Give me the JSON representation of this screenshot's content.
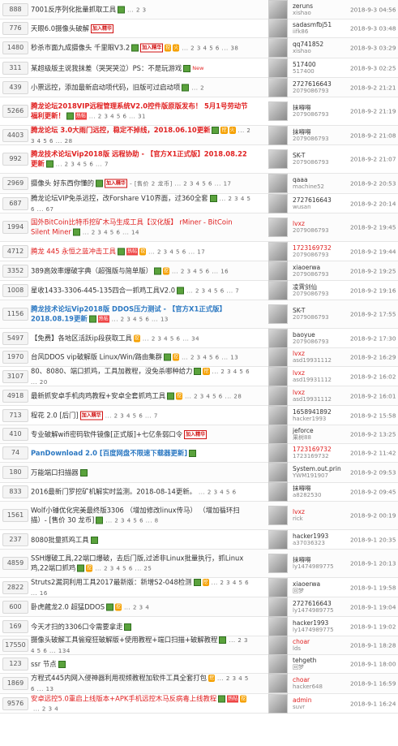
{
  "rows": [
    {
      "count": "888",
      "title": "7001反序列化批量抓取工具",
      "style": "normal",
      "badges": [
        "img"
      ],
      "pages": "... 2 3",
      "author": "zeruns",
      "sub": "xishao",
      "date": "2018-9-3 04:56"
    },
    {
      "count": "776",
      "title": "天眼6.0摄像头破解",
      "style": "normal",
      "badges": [
        "label:加入精华"
      ],
      "pages": "",
      "author": "sadasmfbj51",
      "sub": "iifk86",
      "date": "2018-9-3 03:48"
    },
    {
      "count": "1480",
      "title": "秒杀市面九成摄像头 千里眼V3.2",
      "style": "normal",
      "badges": [
        "img",
        "label:加入精华",
        "dig:挖",
        "dig:火"
      ],
      "pages": "... 2 3 4 5 6 ... 38",
      "author": "qq741852",
      "sub": "xishao",
      "date": "2018-9-3 03:29"
    },
    {
      "count": "311",
      "title": "某超级版主说我抹差（哭哭哭泣）PS：不是玩游戏",
      "style": "normal",
      "badges": [
        "img",
        "new:New"
      ],
      "pages": "",
      "author": "517400",
      "sub": "517400",
      "date": "2018-9-3 02:25"
    },
    {
      "count": "439",
      "title": "小票远控，添加最新启动项代码，旧版可过启动项",
      "style": "normal",
      "badges": [
        "img"
      ],
      "pages": "... 2",
      "author": "2727616643",
      "sub": "2079086793",
      "date": "2018-9-2 21:21"
    },
    {
      "count": "5266",
      "title": "腾龙论坛2018VIP远程管理系统V2.0控件版原版发布！ 5月1号劳动节福利更新！",
      "style": "red",
      "badges": [
        "img",
        "hot:热帖"
      ],
      "pages": "... 2 3 4 5 6 ... 31",
      "author": "抹嘚嘚",
      "sub": "2079086793",
      "date": "2018-9-2 21:19"
    },
    {
      "count": "4403",
      "title": "腾龙论坛 3.0大雨门远控，稳定不掉线，2018.06.10更新",
      "style": "red",
      "badges": [
        "img",
        "dig:挖",
        "dig:火"
      ],
      "pages": "... 2 3 4 5 6 ... 28",
      "author": "抹嘚嘚",
      "sub": "2079086793",
      "date": "2018-9-2 21:08"
    },
    {
      "count": "992",
      "title": "腾龙技术论坛Vip2018版 远程协助 - 【官方X1正式版】2018.08.22更新",
      "style": "red",
      "badges": [
        "img"
      ],
      "pages": "... 2 3 4 5 6 ... 7",
      "author": "SK-T",
      "sub": "2079086793",
      "date": "2018-9-2 21:07"
    },
    {
      "count": "2969",
      "title": "摄像头 好东西你懂的",
      "style": "normal",
      "badges": [
        "img",
        "label:加入精华"
      ],
      "pages": "- [售价 2 龙币] ... 2 3 4 5 6 ... 17",
      "author": "qaaa",
      "sub": "machine52",
      "date": "2018-9-2 20:53"
    },
    {
      "count": "687",
      "title": "腾龙论坛VIP免杀远控，改Forshare V10界面，过360全套",
      "style": "normal",
      "badges": [
        "img"
      ],
      "pages": "... 2 3 4 5 6 ... 67",
      "author": "2727616643",
      "sub": "wusan",
      "date": "2018-9-2 20:14"
    },
    {
      "count": "1994",
      "title": "国外BitCoin比特币挖矿木马生成工具【汉化版】 rMiner - BitCoin Silent Miner",
      "style": "redthin",
      "badges": [
        "img"
      ],
      "pages": "... 2 3 4 5 6 ... 14",
      "author": "lvxz",
      "sub": "2079086793",
      "date": "2018-9-2 19:45"
    },
    {
      "count": "4712",
      "title": "腾龙 445 永恒之蓝冲击工具",
      "style": "redthin",
      "badges": [
        "img",
        "hot:热帖",
        "dig:挖"
      ],
      "pages": "... 2 3 4 5 6 ... 17",
      "author": "1723169732",
      "sub": "2079086793",
      "date": "2018-9-2 19:44"
    },
    {
      "count": "3352",
      "title": "389高效率爆破字典（超强版与简单版）",
      "style": "normal",
      "badges": [
        "img",
        "dig:挖"
      ],
      "pages": "... 2 3 4 5 6 ... 16",
      "author": "xiaoerwa",
      "sub": "2079086793",
      "date": "2018-9-2 19:25"
    },
    {
      "count": "1008",
      "title": "星收1433-3306-445-135四合一抓鸡工具V2.0",
      "style": "normal",
      "badges": [
        "img"
      ],
      "pages": "... 2 3 4 5 6 ... 7",
      "author": "凌霄剑仙",
      "sub": "2079086793",
      "date": "2018-9-2 19:16"
    },
    {
      "count": "1156",
      "title": "腾龙技术论坛Vip2018版 DDOS压力测试 - 【官方X1正式版】2018.08.19更新",
      "style": "blue",
      "badges": [
        "img",
        "hot:热帖"
      ],
      "pages": "... 2 3 4 5 6 ... 13",
      "author": "SK-T",
      "sub": "2079086793",
      "date": "2018-9-2 17:55"
    },
    {
      "count": "5497",
      "title": "【免费】各地区活跃ip段获取工具",
      "style": "normal",
      "badges": [
        "dig:挖"
      ],
      "pages": "... 2 3 4 5 6 ... 34",
      "author": "baoyue",
      "sub": "2079086793",
      "date": "2018-9-2 17:30"
    },
    {
      "count": "1970",
      "title": "台风DDOS vip破解版 Linux/Win/路由集群",
      "style": "normal",
      "badges": [
        "img",
        "dig:挖"
      ],
      "pages": "... 2 3 4 5 6 ... 13",
      "author": "lvxz",
      "sub": "asd19931112",
      "date": "2018-9-2 16:29"
    },
    {
      "count": "3107",
      "title": "80、8080、端口抓鸡，工具加教程，没免杀哪种给力",
      "style": "normal",
      "badges": [
        "img",
        "dig:挖"
      ],
      "pages": "... 2 3 4 5 6 ... 20",
      "author": "lvxz",
      "sub": "asd19931112",
      "date": "2018-9-2 16:02"
    },
    {
      "count": "4918",
      "title": "最新抓安卓手机肉鸡教程+安卓全套抓鸡工具",
      "style": "normal",
      "badges": [
        "img",
        "dig:挖"
      ],
      "pages": "... 2 3 4 5 6 ... 28",
      "author": "lvxz",
      "sub": "asd19931112",
      "date": "2018-9-2 16:01"
    },
    {
      "count": "713",
      "title": "程花 2.0 [后门]",
      "style": "normal",
      "badges": [
        "label:加入精华"
      ],
      "pages": "... 2 3 4 5 6 ... 7",
      "author": "1658941892",
      "sub": "hacker1993",
      "date": "2018-9-2 15:58"
    },
    {
      "count": "410",
      "title": "专业破解wifi密码软件镜像[正式版]+七亿条弱口令",
      "style": "normal",
      "badges": [
        "label:加入精华"
      ],
      "pages": "",
      "author": "jeforce",
      "sub": "果树88",
      "date": "2018-9-2 13:25"
    },
    {
      "count": "74",
      "title": "PanDownload 2.0 [百度网盘不限速下载器更新]",
      "style": "blue",
      "badges": [
        "img"
      ],
      "pages": "",
      "author": "1723169732",
      "sub": "1723169732",
      "date": "2018-9-2 11:42"
    },
    {
      "count": "180",
      "title": "万能端口扫描器",
      "style": "normal",
      "badges": [
        "img"
      ],
      "pages": "",
      "author": "System.out.prin",
      "sub": "YWM191907",
      "date": "2018-9-2 09:53"
    },
    {
      "count": "833",
      "title": "2016最新门罗挖矿机解实时监测。2018-08-14更新。",
      "style": "normal",
      "badges": [],
      "pages": "... 2 3 4 5 6",
      "author": "抹嘚嘚",
      "sub": "a8282530",
      "date": "2018-9-2 09:45"
    },
    {
      "count": "1561",
      "title": "Wolf小锤优化完美最终版3306 （增加修改linux传马） （增加循环扫描）- [售价 30 龙币]",
      "style": "normal",
      "badges": [
        "img"
      ],
      "pages": "... 2 3 4 5 6 ... 8",
      "author": "lvxz",
      "sub": "rick",
      "date": "2018-9-2 00:19"
    },
    {
      "count": "237",
      "title": "8080批量抓鸡工具",
      "style": "normal",
      "badges": [
        "img"
      ],
      "pages": "",
      "author": "hacker1993",
      "sub": "a37036323",
      "date": "2018-9-1 20:35"
    },
    {
      "count": "4859",
      "title": "SSH爆破工具,22端口爆破，去后门版,过滤非Linux批量执行，抓Linux鸡,22端口抓鸡",
      "style": "normal",
      "badges": [
        "img",
        "dig:挖"
      ],
      "pages": "... 2 3 4 5 6 ... 25",
      "author": "抹嘚嘚",
      "sub": "ly1474989775",
      "date": "2018-9-1 20:13"
    },
    {
      "count": "2822",
      "title": "Struts2漏洞利用工具2017最新版：新增S2-048检测",
      "style": "normal",
      "badges": [
        "img",
        "dig:挖"
      ],
      "pages": "... 2 3 4 5 6 ... 16",
      "author": "xiaoerwa",
      "sub": "回梦",
      "date": "2018-9-1 19:58"
    },
    {
      "count": "600",
      "title": "卧虎藏龙2.0 超猛DDOS",
      "style": "normal",
      "badges": [
        "img",
        "dig:挖"
      ],
      "pages": "... 2 3 4",
      "author": "2727616643",
      "sub": "ly1474989775",
      "date": "2018-9-1 19:04"
    },
    {
      "count": "169",
      "title": "今天才扫的3306口令需要拿走",
      "style": "normal",
      "badges": [
        "img"
      ],
      "pages": "",
      "author": "hacker1993",
      "sub": "ly1474989775",
      "date": "2018-9-1 19:02"
    },
    {
      "count": "17550",
      "title": "摄像头破解工具偷窥狂破解版+使用教程+端口扫描+破解教程",
      "style": "normal",
      "badges": [
        "img"
      ],
      "pages": "... 2 3 4 5 6 ... 134",
      "author": "choar",
      "sub": "lds",
      "date": "2018-9-1 18:28"
    },
    {
      "count": "123",
      "title": "ssr 节点",
      "style": "normal",
      "badges": [
        "img"
      ],
      "pages": "",
      "author": "tehgeth",
      "sub": "回梦",
      "date": "2018-9-1 18:00"
    },
    {
      "count": "1869",
      "title": "方程式445内网入侵神器利用视频教程加软件工具全套打包",
      "style": "normal",
      "badges": [
        "dig:挖"
      ],
      "pages": "... 2 3 4 5 6 ... 13",
      "author": "choar",
      "sub": "hacker648",
      "date": "2018-9-1 16:59"
    },
    {
      "count": "9576",
      "title": "安卓远控5.0重启上线版本+APK手机远控木马反病毒上线教程",
      "style": "redthin",
      "badges": [
        "img",
        "hot:热帖",
        "dig:挖"
      ],
      "pages": "... 2 3 4",
      "author": "admin",
      "sub": "suvr",
      "date": "2018-9-1 16:24"
    }
  ]
}
